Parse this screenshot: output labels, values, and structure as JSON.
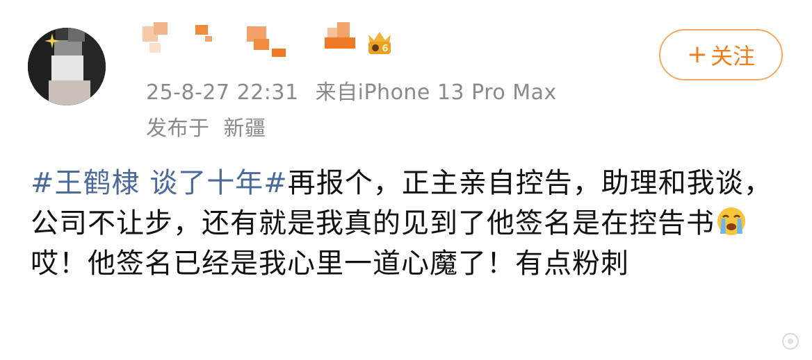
{
  "post": {
    "timestamp": "25-8-27 22:31",
    "source": "来自iPhone 13 Pro Max",
    "location_prefix": "发布于",
    "location": "新疆",
    "follow_button": {
      "icon": "plus-icon",
      "plus": "+",
      "label": "关注"
    },
    "topic": "#王鹤棣 谈了十年#",
    "content_before_emoji": "再报个，正主亲自控告，助理和我谈，公司不让步，还有就是我真的见到了他签名是在控告书",
    "emoji": "crying-face-emoji",
    "content_after_emoji": "哎！他签名已经是我心里一道心魔了！有点粉刺"
  },
  "colors": {
    "topic": "#4b6a9b",
    "meta": "#8a8a8a",
    "follow_accent": "#f07c1a",
    "follow_border": "#f5a862"
  }
}
